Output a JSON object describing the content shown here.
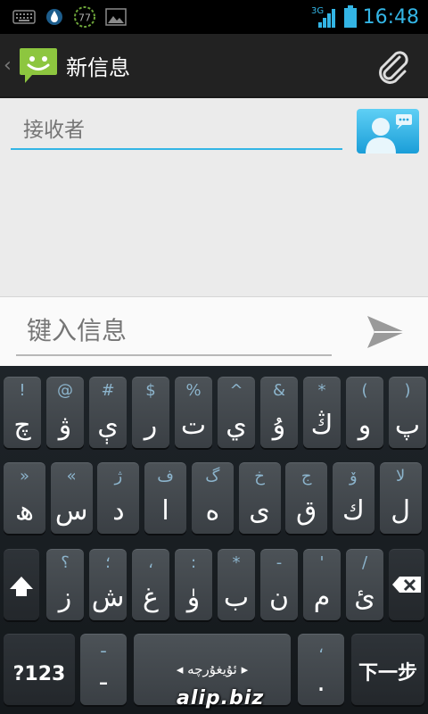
{
  "status_bar": {
    "network": "3G",
    "battery_level": 0.85,
    "time": "16:48",
    "badge_count": "77",
    "icons": [
      "keyboard-icon",
      "droplet-icon",
      "badge-icon",
      "image-icon",
      "signal-icon",
      "battery-icon"
    ]
  },
  "action_bar": {
    "title": "新信息",
    "back_glyph": "‹",
    "attach_icon": "paperclip-icon"
  },
  "recipient": {
    "placeholder": "接收者",
    "value": ""
  },
  "compose": {
    "placeholder": "键入信息",
    "value": ""
  },
  "keyboard": {
    "row1": [
      {
        "hint": "!",
        "main": "چ"
      },
      {
        "hint": "@",
        "main": "ۋ"
      },
      {
        "hint": "#",
        "main": "ې"
      },
      {
        "hint": "$",
        "main": "ر"
      },
      {
        "hint": "%",
        "main": "ت"
      },
      {
        "hint": "^",
        "main": "ي"
      },
      {
        "hint": "&",
        "main": "ۇ"
      },
      {
        "hint": "*",
        "main": "ڭ"
      },
      {
        "hint": "(",
        "main": "و"
      },
      {
        "hint": ")",
        "main": "پ"
      }
    ],
    "row2": [
      {
        "hint": "»",
        "main": "ھ"
      },
      {
        "hint": "«",
        "main": "س"
      },
      {
        "hint": "ژ",
        "main": "د"
      },
      {
        "hint": "ف",
        "main": "ا"
      },
      {
        "hint": "گ",
        "main": "ە"
      },
      {
        "hint": "خ",
        "main": "ى"
      },
      {
        "hint": "ج",
        "main": "ق"
      },
      {
        "hint": "ۆ",
        "main": "ك"
      },
      {
        "hint": "لا",
        "main": "ل"
      }
    ],
    "row3": [
      {
        "hint": "؟",
        "main": "ز"
      },
      {
        "hint": "؛",
        "main": "ش"
      },
      {
        "hint": "،",
        "main": "غ"
      },
      {
        "hint": ":",
        "main": "ۈ"
      },
      {
        "hint": "*",
        "main": "ب"
      },
      {
        "hint": "-",
        "main": "ن"
      },
      {
        "hint": "'",
        "main": "م"
      },
      {
        "hint": "/",
        "main": "ئ"
      }
    ],
    "row4": {
      "sym": "?123",
      "comma_hint": "ـ",
      "comma_main": "-",
      "space_label": "ئۇيغۇرچە",
      "period_hint": "،",
      "period_main": ".",
      "next_label": "下一步"
    }
  },
  "watermark": "alip.biz",
  "colors": {
    "accent": "#33b5e5",
    "keyboard_bg": "#1a1f23"
  }
}
